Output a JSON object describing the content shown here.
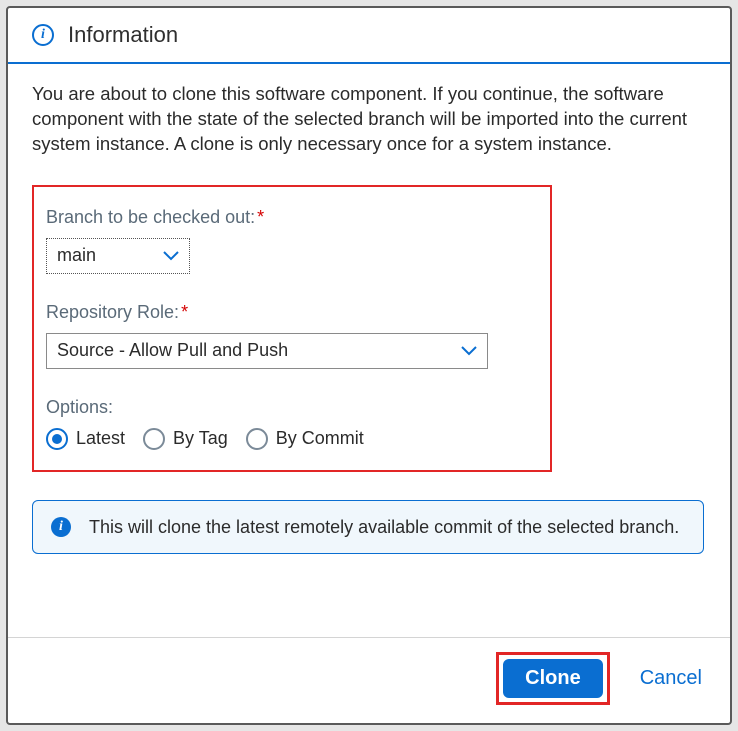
{
  "dialog": {
    "title": "Information",
    "intro": "You are about to clone this software component. If you continue, the software component with the state of the selected branch will be imported into the current system instance. A clone is only necessary once for a system instance."
  },
  "form": {
    "branch_label": "Branch to be checked out:",
    "branch_value": "main",
    "role_label": "Repository Role:",
    "role_value": "Source - Allow Pull and Push",
    "options_label": "Options:",
    "options": {
      "latest": "Latest",
      "by_tag": "By Tag",
      "by_commit": "By Commit"
    },
    "selected_option": "latest"
  },
  "message": "This will clone the latest remotely available commit of the selected branch.",
  "footer": {
    "clone": "Clone",
    "cancel": "Cancel"
  }
}
